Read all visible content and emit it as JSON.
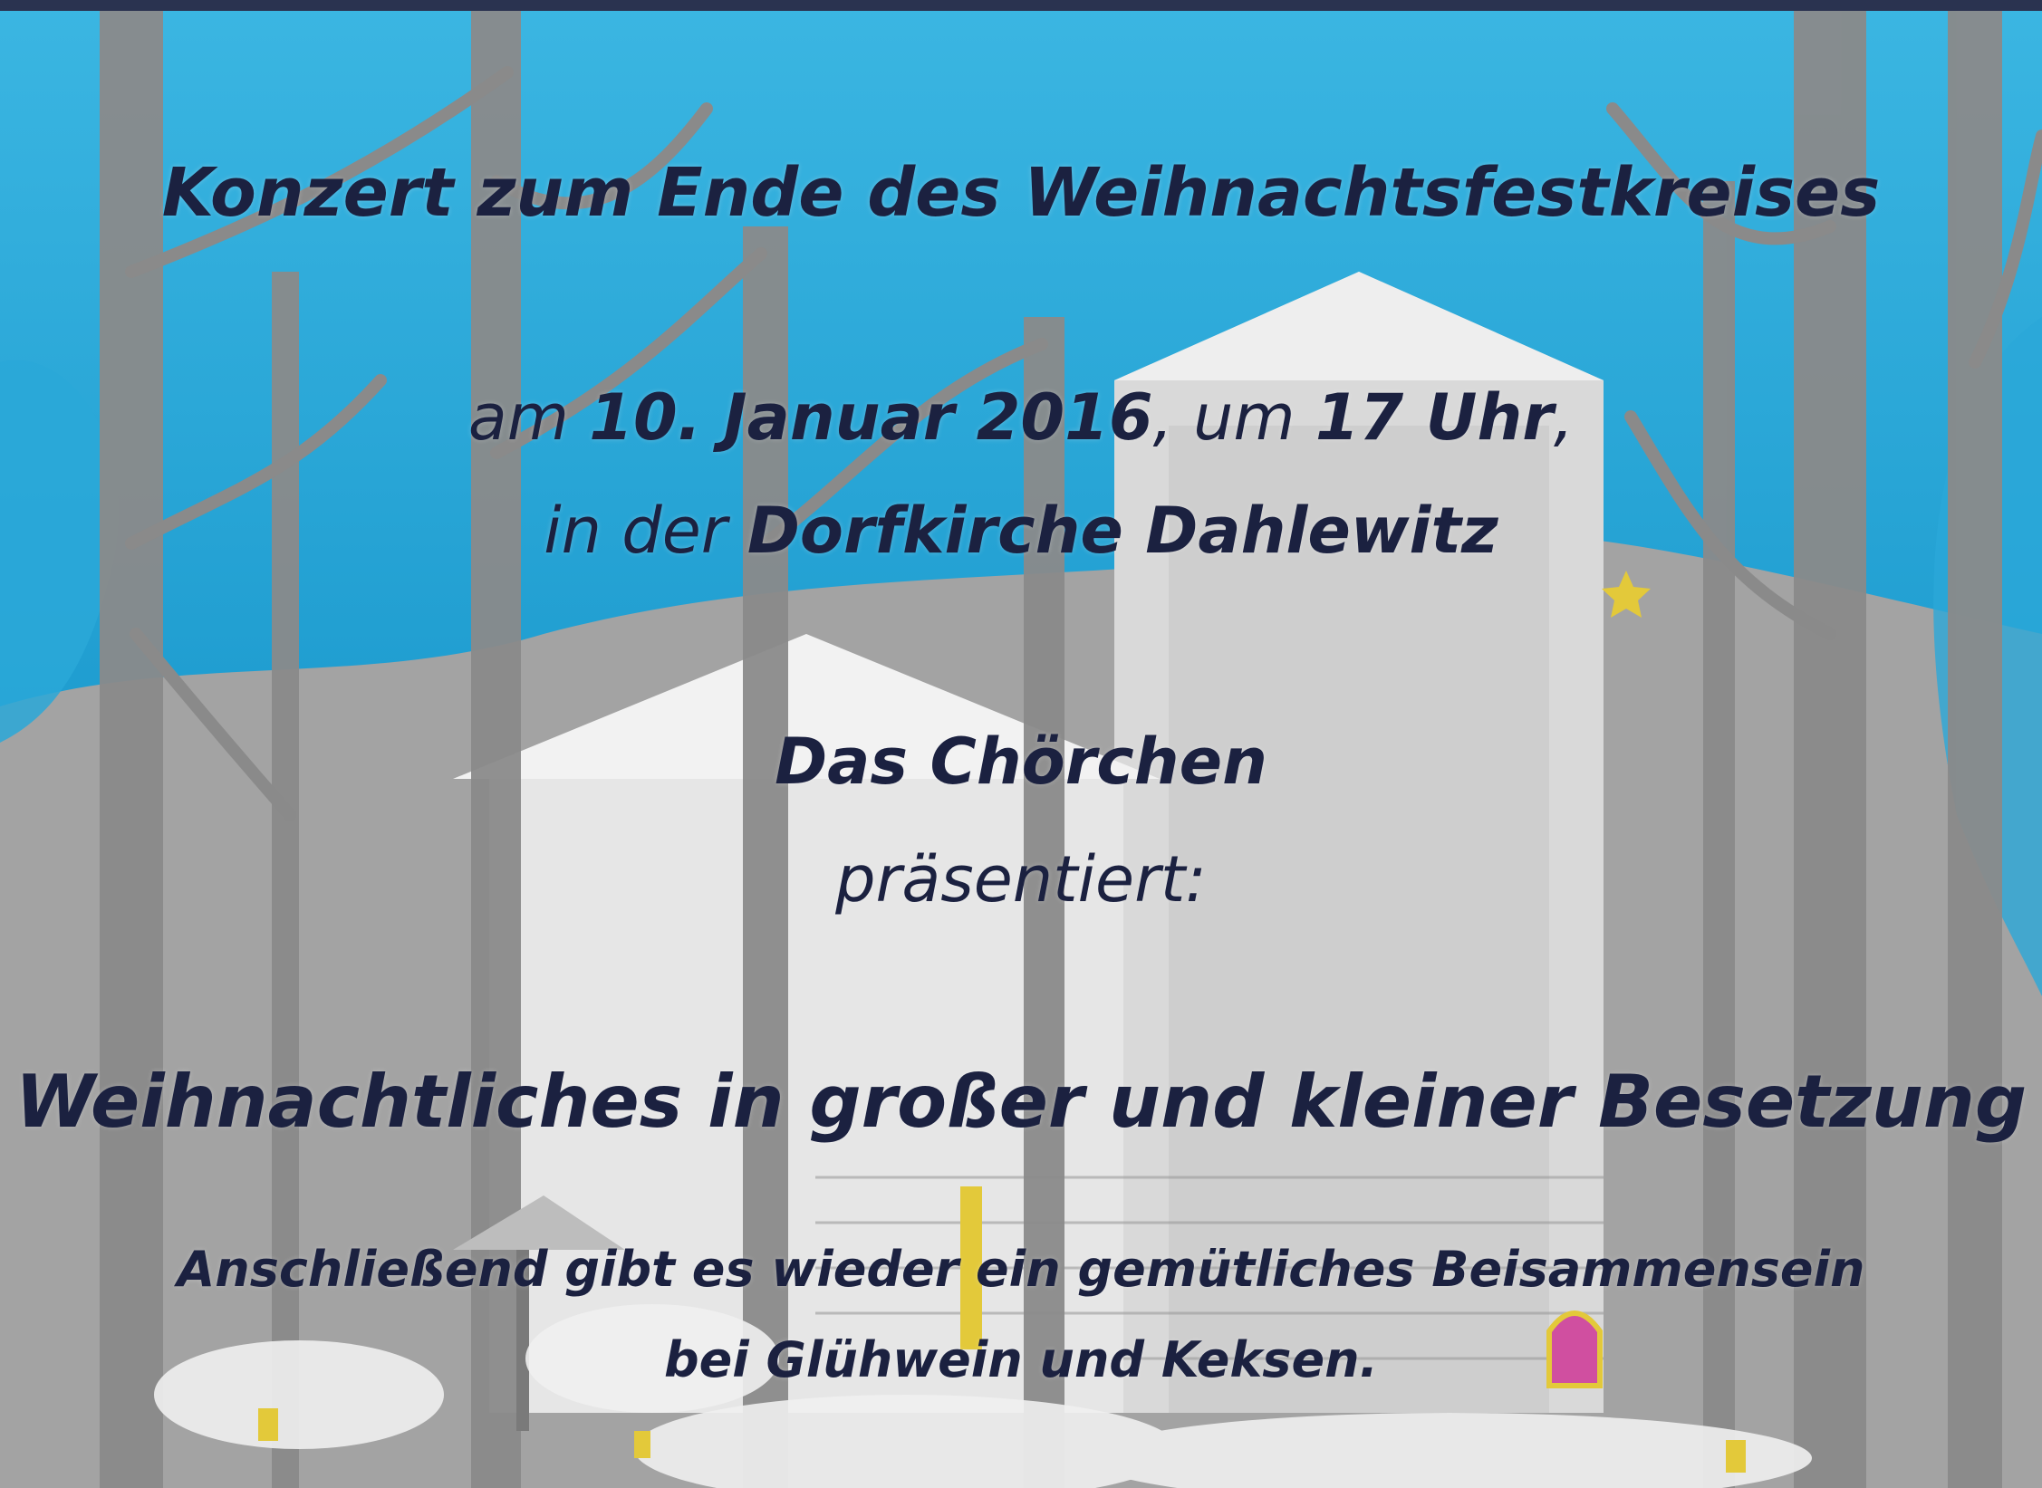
{
  "flyer": {
    "headline": "Konzert zum Ende des Weihnachtsfestkreises",
    "date_line": {
      "prefix": "am ",
      "date": "10. Januar 2016",
      "middle": ", um ",
      "time": "17 Uhr",
      "suffix": ","
    },
    "place_line": {
      "prefix": "in der ",
      "place": "Dorfkirche Dahlewitz"
    },
    "ensemble": "Das Chörchen",
    "presents": "präsentiert:",
    "program_title": "Weihnachtliches in großer und kleiner Besetzung",
    "note_line_1": "Anschließend gibt es wieder ein gemütliches Beisammensein",
    "note_line_2": "bei Glühwein und Keksen."
  },
  "colors": {
    "text": "#1b2140",
    "sky": "#2aa8d8",
    "trees": "#8f8f8f",
    "church": "#e8e8e8"
  }
}
